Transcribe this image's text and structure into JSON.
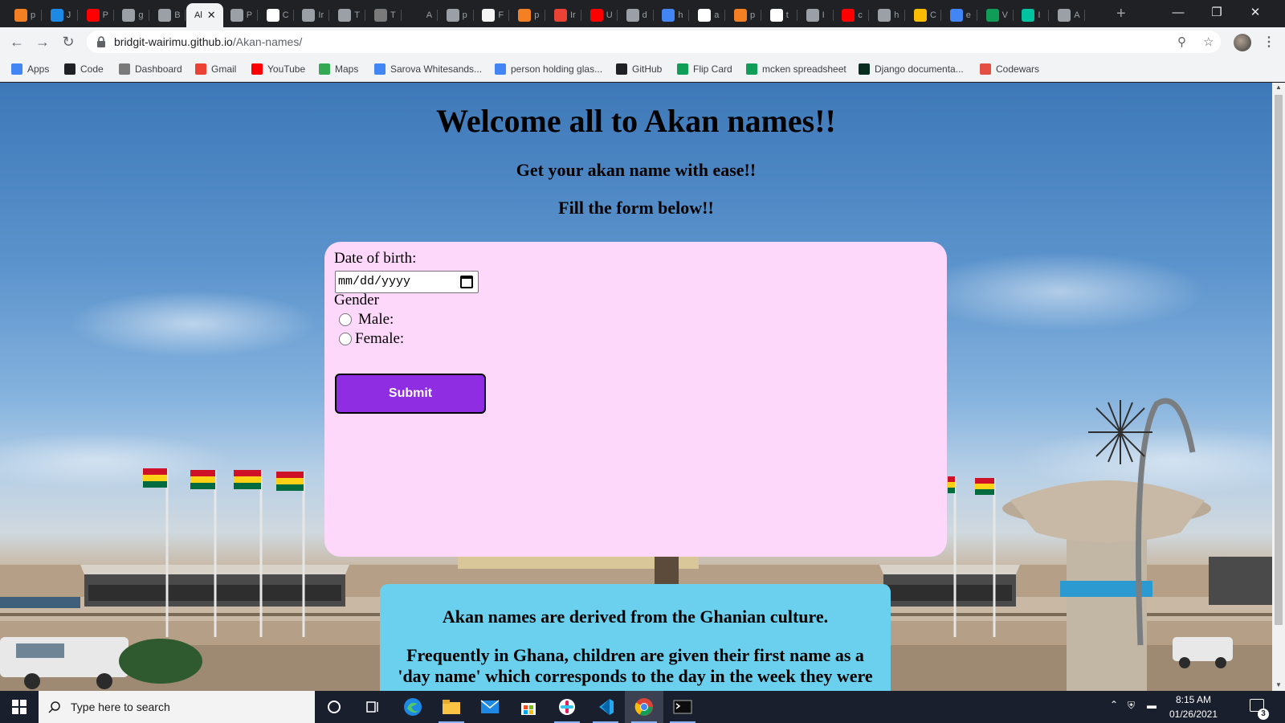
{
  "browser": {
    "active_tab": {
      "title": "Al",
      "close": "✕"
    },
    "tabs": [
      {
        "label": "p",
        "color": "#f48024"
      },
      {
        "label": "J",
        "color": "#1e88e5"
      },
      {
        "label": "P",
        "color": "#ff0000"
      },
      {
        "label": "g",
        "color": "#9aa0a6"
      },
      {
        "label": "B",
        "color": "#9aa0a6"
      },
      {
        "label": "P",
        "color": "#9aa0a6"
      },
      {
        "label": "C",
        "color": "#ffffff"
      },
      {
        "label": "Ir",
        "color": "#9aa0a6"
      },
      {
        "label": "T",
        "color": "#9aa0a6"
      },
      {
        "label": "T",
        "color": "#7a7a7a"
      },
      {
        "label": "A",
        "color": "#202124"
      },
      {
        "label": "p",
        "color": "#9aa0a6"
      },
      {
        "label": "F",
        "color": "#f5f5f5"
      },
      {
        "label": "p",
        "color": "#f48024"
      },
      {
        "label": "Ir",
        "color": "#ea4335"
      },
      {
        "label": "U",
        "color": "#ff0000"
      },
      {
        "label": "d",
        "color": "#9aa0a6"
      },
      {
        "label": "h",
        "color": "#4285f4"
      },
      {
        "label": "a",
        "color": "#ffffff"
      },
      {
        "label": "p",
        "color": "#f48024"
      },
      {
        "label": "t",
        "color": "#ffffff"
      },
      {
        "label": "I",
        "color": "#9aa0a6"
      },
      {
        "label": "c",
        "color": "#ff0000"
      },
      {
        "label": "h",
        "color": "#9aa0a6"
      },
      {
        "label": "C",
        "color": "#fbbc04"
      },
      {
        "label": "e",
        "color": "#4285f4"
      },
      {
        "label": "V",
        "color": "#0f9d58"
      },
      {
        "label": "I",
        "color": "#00c4a0"
      },
      {
        "label": "A",
        "color": "#9aa0a6"
      }
    ],
    "new_tab": "+",
    "window_controls": {
      "minimize": "—",
      "restore": "❐",
      "close": "✕"
    },
    "url_host": "bridgit-wairimu.github.io",
    "url_path": "/Akan-names/",
    "bookmarks": [
      {
        "label": "Apps",
        "icon": "apps-grid-icon",
        "color": "#4285f4"
      },
      {
        "label": "Code",
        "icon": "github-icon",
        "color": "#202124"
      },
      {
        "label": "Dashboard",
        "icon": "dashboard-icon",
        "color": "#7a7a7a"
      },
      {
        "label": "Gmail",
        "icon": "gmail-icon",
        "color": "#ea4335"
      },
      {
        "label": "YouTube",
        "icon": "youtube-icon",
        "color": "#ff0000"
      },
      {
        "label": "Maps",
        "icon": "maps-icon",
        "color": "#34a853"
      },
      {
        "label": "Sarova Whitesands...",
        "icon": "google-icon",
        "color": "#4285f4"
      },
      {
        "label": "person holding glas...",
        "icon": "google-icon",
        "color": "#4285f4"
      },
      {
        "label": "GitHub",
        "icon": "github-icon",
        "color": "#202124"
      },
      {
        "label": "Flip Card",
        "icon": "w-icon",
        "color": "#0f9d58"
      },
      {
        "label": "mcken spreadsheet",
        "icon": "sheets-icon",
        "color": "#0f9d58"
      },
      {
        "label": "Django documenta...",
        "icon": "django-icon",
        "color": "#092e20"
      },
      {
        "label": "Codewars",
        "icon": "codewars-icon",
        "color": "#e34f42"
      }
    ]
  },
  "page": {
    "heading": "Welcome all to Akan names!!",
    "subheading": "Get your akan name with ease!!",
    "instruction": "Fill the form below!!",
    "form": {
      "dob_label": "Date of birth:",
      "dob_placeholder": "mm/dd/yyyy",
      "gender_label": "Gender",
      "male_label": "Male:",
      "female_label": "Female:",
      "submit_label": "Submit"
    },
    "info": {
      "line1": "Akan names are derived from the Ghanian culture.",
      "line2": "Frequently in Ghana, children are given their first name as a 'day name' which corresponds to the day in the week they were"
    }
  },
  "taskbar": {
    "search_placeholder": "Type here to search",
    "time": "8:15 AM",
    "date": "01/26/2021",
    "notification_count": "3",
    "apps": [
      "cortana-icon",
      "task-view-icon",
      "edge-icon",
      "file-explorer-icon",
      "mail-icon",
      "store-icon",
      "slack-icon",
      "vscode-icon",
      "chrome-icon",
      "terminal-icon"
    ]
  },
  "colors": {
    "form_card": "#fdd8fb",
    "info_card": "#6bd0ee",
    "submit_button": "#8e2de2"
  }
}
